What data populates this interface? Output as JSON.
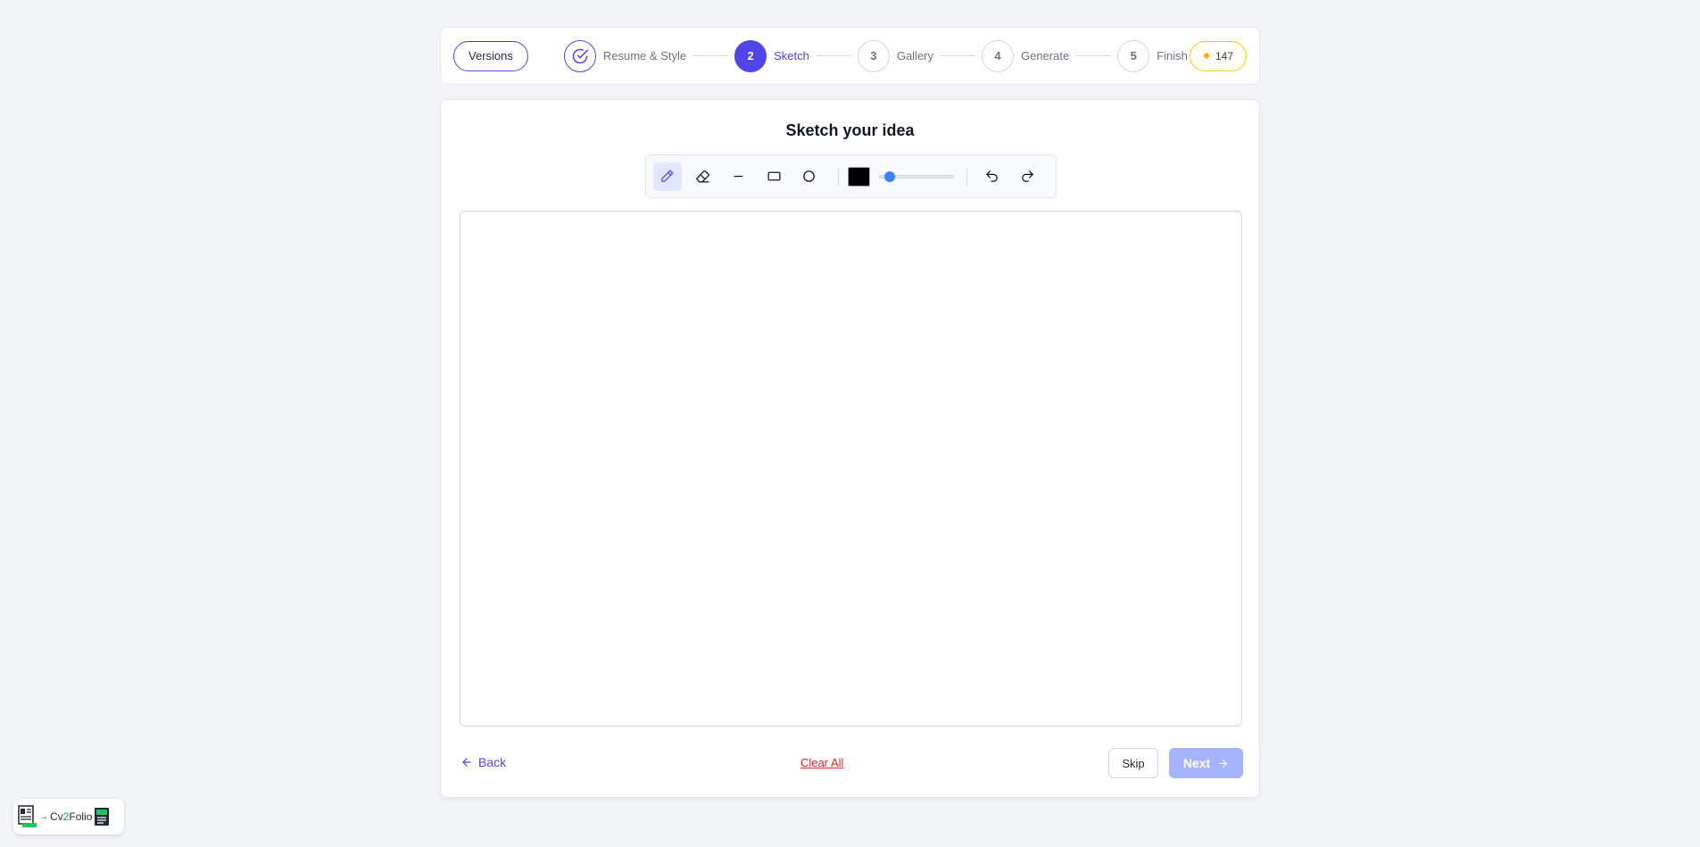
{
  "header": {
    "versions_label": "Versions",
    "steps": [
      {
        "number": "",
        "label": "Resume & Style",
        "state": "done"
      },
      {
        "number": "2",
        "label": "Sketch",
        "state": "active"
      },
      {
        "number": "3",
        "label": "Gallery",
        "state": "upcoming"
      },
      {
        "number": "4",
        "label": "Generate",
        "state": "upcoming"
      },
      {
        "number": "5",
        "label": "Finish",
        "state": "upcoming"
      }
    ],
    "credits": "147"
  },
  "main": {
    "title": "Sketch your idea",
    "toolbar": {
      "tools": [
        "pencil-icon",
        "eraser-icon",
        "line-icon",
        "rectangle-icon",
        "circle-icon"
      ],
      "active_tool": "pencil",
      "color": "#000000",
      "brush_size_fraction": 0.05,
      "undo_icon": "undo-icon",
      "redo_icon": "redo-icon"
    }
  },
  "footer": {
    "back_label": "Back",
    "clear_label": "Clear All",
    "skip_label": "Skip",
    "next_label": "Next"
  },
  "logo": {
    "text_a": "Cv",
    "text_b": "2",
    "text_c": "Folio"
  },
  "colors": {
    "primary": "#4f46e5",
    "next_disabled": "#a5b4fc",
    "clear": "#dc2626",
    "credits_border": "#facc15"
  }
}
